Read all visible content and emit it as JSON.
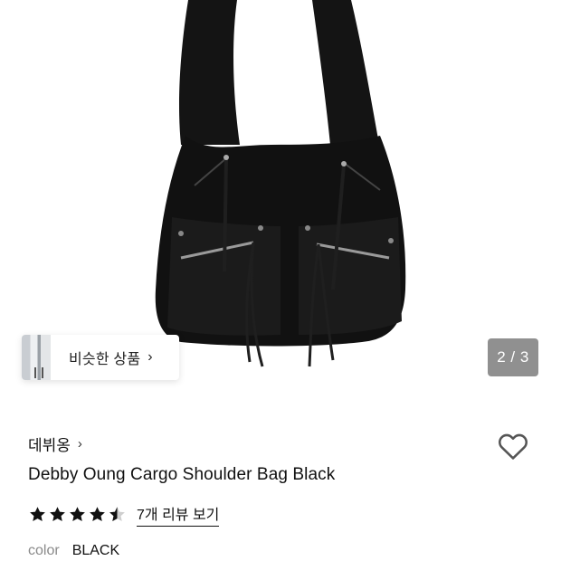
{
  "gallery": {
    "current_page": 2,
    "total_pages": 3,
    "indicator_text": "2 / 3",
    "image_subject": "black cargo shoulder bag"
  },
  "similar_products": {
    "label": "비슷한 상품",
    "chevron": "›"
  },
  "brand": {
    "name": "데뷔옹",
    "chevron": "›"
  },
  "product": {
    "title": "Debby Oung Cargo Shoulder Bag Black",
    "rating": 4.5,
    "review_link_text": "7개 리뷰 보기",
    "color_label": "color",
    "color_value": "BLACK"
  },
  "colors": {
    "star": "#111111",
    "star_empty": "#cfcfcf",
    "heart_outline": "#555555",
    "indicator_bg": "#7a7a7a"
  },
  "icons": {
    "wishlist": "heart-outline-icon",
    "star": "star-icon"
  }
}
